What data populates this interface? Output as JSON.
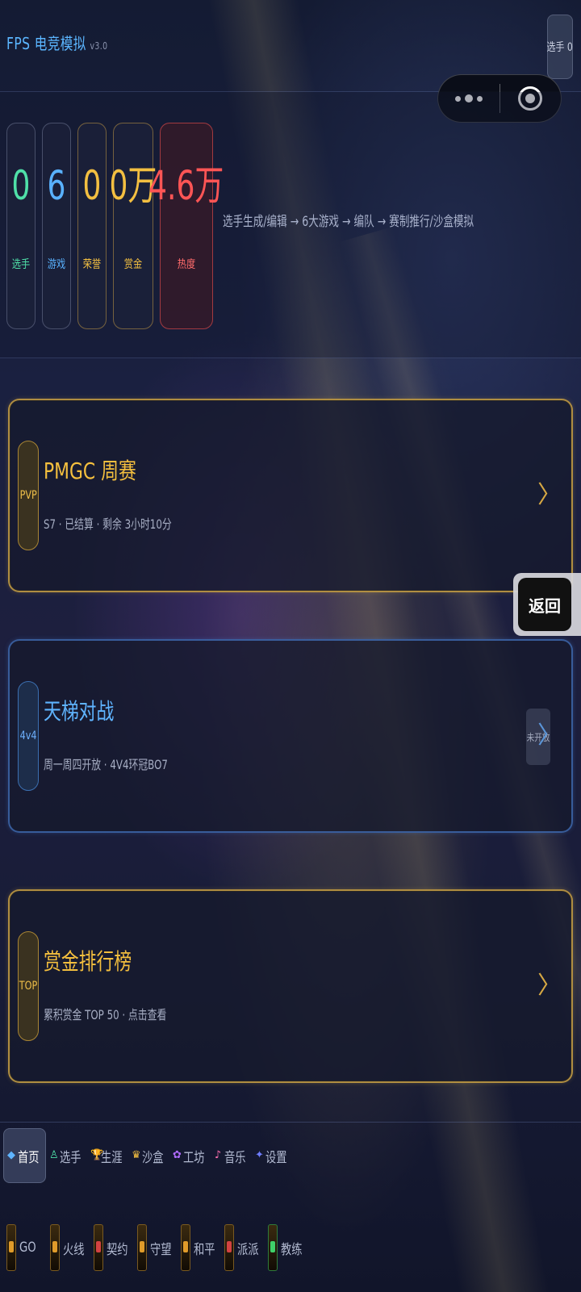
{
  "header": {
    "title": "FPS 电竞模拟",
    "version": "v3.0",
    "player_chip": "选手 0"
  },
  "stats": [
    {
      "value": "0",
      "label": "选手",
      "color": "#4fe0a8"
    },
    {
      "value": "6",
      "label": "游戏",
      "color": "#59b2ff"
    },
    {
      "value": "0",
      "label": "荣誉",
      "color": "#f3bf41"
    },
    {
      "value": "0万",
      "label": "赏金",
      "color": "#f3bf41"
    },
    {
      "value": "4.6万",
      "label": "热度",
      "color": "#ff5555"
    }
  ],
  "flow_text": "选手生成/编辑 → 6大游戏 → 编队 → 赛制推行/沙盒模拟",
  "cards": [
    {
      "badge": "PVP",
      "title": "PMGC 周赛",
      "subtitle": "S7 · 已结算 · 剩余 3小时10分",
      "chevron": "〉"
    },
    {
      "badge": "4v4",
      "title": "天梯对战",
      "subtitle": "周一周四开放 · 4V4环冠BO7",
      "tag": "未开放",
      "chevron": "〉"
    },
    {
      "badge": "TOP",
      "title": "赏金排行榜",
      "subtitle": "累积赏金 TOP 50 · 点击查看",
      "chevron": "〉"
    }
  ],
  "float_back": "返回",
  "nav": {
    "row1": [
      {
        "icon": "◆",
        "label": "首页",
        "active": true,
        "icon_color": "#5fb4ff"
      },
      {
        "icon": "♙",
        "label": "选手",
        "active": false,
        "icon_color": "#4fe0a8"
      },
      {
        "icon": "🏆",
        "label": "生涯",
        "active": false,
        "icon_color": "#f3bf41"
      },
      {
        "icon": "♛",
        "label": "沙盒",
        "active": false,
        "icon_color": "#f3bf41"
      },
      {
        "icon": "✿",
        "label": "工坊",
        "active": false,
        "icon_color": "#b06bff"
      },
      {
        "icon": "♪",
        "label": "音乐",
        "active": false,
        "icon_color": "#ff6fb0"
      },
      {
        "icon": "✦",
        "label": "设置",
        "active": false,
        "icon_color": "#6f7dff"
      }
    ],
    "row2": [
      {
        "label": "GO",
        "style": "gold"
      },
      {
        "label": "火线",
        "style": "gold"
      },
      {
        "label": "契约",
        "style": "red"
      },
      {
        "label": "守望",
        "style": "gold"
      },
      {
        "label": "和平",
        "style": "gold"
      },
      {
        "label": "派派",
        "style": "red"
      },
      {
        "label": "教练",
        "style": "green"
      }
    ]
  }
}
